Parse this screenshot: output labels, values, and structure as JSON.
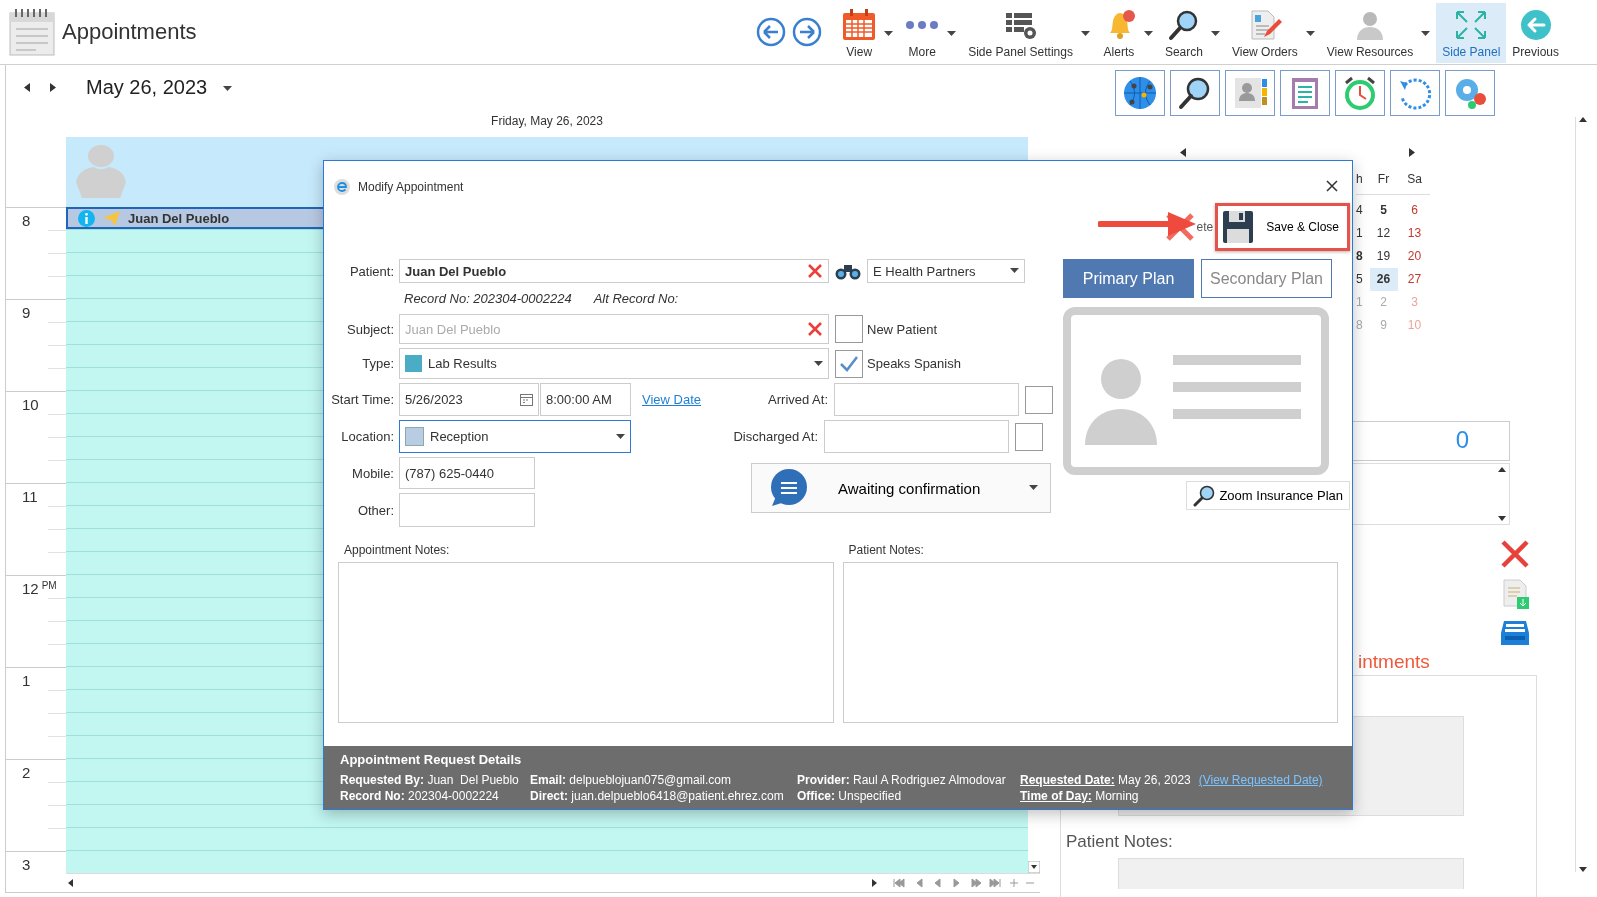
{
  "app": {
    "title": "Appointments"
  },
  "toolbar": [
    {
      "label": "View",
      "dropdown": true,
      "selected": false
    },
    {
      "label": "More",
      "dropdown": true,
      "selected": false
    },
    {
      "label": "Side Panel Settings",
      "dropdown": true,
      "selected": false
    },
    {
      "label": "Alerts",
      "dropdown": true,
      "selected": false
    },
    {
      "label": "Search",
      "dropdown": true,
      "selected": false
    },
    {
      "label": "View Orders",
      "dropdown": true,
      "selected": false
    },
    {
      "label": "View Resources",
      "dropdown": true,
      "selected": false
    },
    {
      "label": "Side Panel",
      "dropdown": false,
      "selected": true
    },
    {
      "label": "Previous",
      "dropdown": false,
      "selected": false
    }
  ],
  "calendar": {
    "date": "May 26, 2023",
    "day_heading": "Friday, May 26, 2023",
    "appointment": "Juan Del Pueblo",
    "hours": [
      {
        "hour": "8"
      },
      {
        "hour": "9"
      },
      {
        "hour": "10"
      },
      {
        "hour": "11"
      },
      {
        "hour": "12",
        "period": "PM"
      },
      {
        "hour": "1"
      },
      {
        "hour": "2"
      },
      {
        "hour": "3"
      }
    ]
  },
  "mini_calendar": {
    "columns": [
      {
        "heading": "h",
        "weekend": false,
        "days": [
          {
            "day": "4",
            "bold": false,
            "muted": false,
            "selected": false
          },
          {
            "day": "1",
            "bold": false,
            "muted": false,
            "selected": false
          },
          {
            "day": "8",
            "bold": true,
            "muted": false,
            "selected": false
          },
          {
            "day": "5",
            "bold": false,
            "muted": false,
            "selected": false
          },
          {
            "day": "1",
            "bold": false,
            "muted": true,
            "selected": false
          },
          {
            "day": "8",
            "bold": false,
            "muted": true,
            "selected": false
          }
        ]
      },
      {
        "heading": "Fr",
        "weekend": false,
        "days": [
          {
            "day": "5",
            "bold": true,
            "muted": false,
            "selected": false
          },
          {
            "day": "12",
            "bold": false,
            "muted": false,
            "selected": false
          },
          {
            "day": "19",
            "bold": false,
            "muted": false,
            "selected": false
          },
          {
            "day": "26",
            "bold": true,
            "muted": false,
            "selected": true
          },
          {
            "day": "2",
            "bold": false,
            "muted": true,
            "selected": false
          },
          {
            "day": "9",
            "bold": false,
            "muted": true,
            "selected": false
          }
        ]
      },
      {
        "heading": "Sa",
        "weekend": true,
        "days": [
          {
            "day": "6",
            "bold": false,
            "muted": false,
            "selected": false
          },
          {
            "day": "13",
            "bold": false,
            "muted": false,
            "selected": false
          },
          {
            "day": "20",
            "bold": false,
            "muted": false,
            "selected": false
          },
          {
            "day": "27",
            "bold": false,
            "muted": false,
            "selected": false
          },
          {
            "day": "3",
            "bold": false,
            "muted": true,
            "selected": false
          },
          {
            "day": "10",
            "bold": false,
            "muted": true,
            "selected": false
          }
        ]
      }
    ]
  },
  "side_panel": {
    "count": "0",
    "heading": "intments",
    "notes_label": "Patient Notes:"
  },
  "dialog": {
    "title": "Modify Appointment",
    "delete_label": "ete",
    "save_label": "Save & Close",
    "patient": {
      "label": "Patient:",
      "value": "Juan Del Pueblo"
    },
    "insurer": {
      "value": "E Health Partners"
    },
    "record_no": "Record No: 202304-0002224",
    "alt_record_no": "Alt Record No:",
    "subject": {
      "label": "Subject:",
      "placeholder": "Juan Del Pueblo"
    },
    "new_patient": {
      "label": "New Patient",
      "checked": false
    },
    "type": {
      "label": "Type:",
      "value": "Lab Results"
    },
    "speaks_spanish": {
      "label": "Speaks Spanish",
      "checked": true
    },
    "start_time": {
      "label": "Start Time:",
      "date": "5/26/2023",
      "time": "8:00:00 AM",
      "link": "View Date"
    },
    "arrived": {
      "label": "Arrived At:",
      "checked": false
    },
    "location": {
      "label": "Location:",
      "value": "Reception"
    },
    "discharged": {
      "label": "Discharged At:",
      "checked": false
    },
    "mobile": {
      "label": "Mobile:",
      "value": "(787) 625-0440"
    },
    "other": {
      "label": "Other:"
    },
    "status": {
      "value": "Awaiting confirmation"
    },
    "plans": [
      {
        "label": "Primary Plan",
        "selected": true
      },
      {
        "label": "Secondary Plan",
        "selected": false
      }
    ],
    "zoom_button": "Zoom Insurance Plan",
    "appointment_notes": {
      "label": "Appointment Notes:"
    },
    "patient_notes": {
      "label": "Patient Notes:"
    },
    "request": {
      "title": "Appointment Request Details",
      "columns": [
        [
          {
            "label": "Requested By:",
            "value": "Juan  Del Pueblo",
            "underlined": false
          },
          {
            "label": "Record No:",
            "value": "202304-0002224",
            "underlined": false
          }
        ],
        [
          {
            "label": "Email:",
            "value": "delpueblojuan075@gmail.com",
            "underlined": false
          },
          {
            "label": "Direct:",
            "value": "juan.delpueblo6418@patient.ehrez.com",
            "underlined": false
          }
        ],
        [
          {
            "label": "Provider:",
            "value": "Raul A Rodriguez Almodovar",
            "underlined": false
          },
          {
            "label": "Office:",
            "value": "Unspecified",
            "underlined": false
          }
        ],
        [
          {
            "label": "Requested Date:",
            "value": "May 26, 2023",
            "link": "(View Requested Date)",
            "underlined": true
          },
          {
            "label": "Time of Day:",
            "value": "Morning",
            "underlined": true
          }
        ]
      ]
    }
  }
}
